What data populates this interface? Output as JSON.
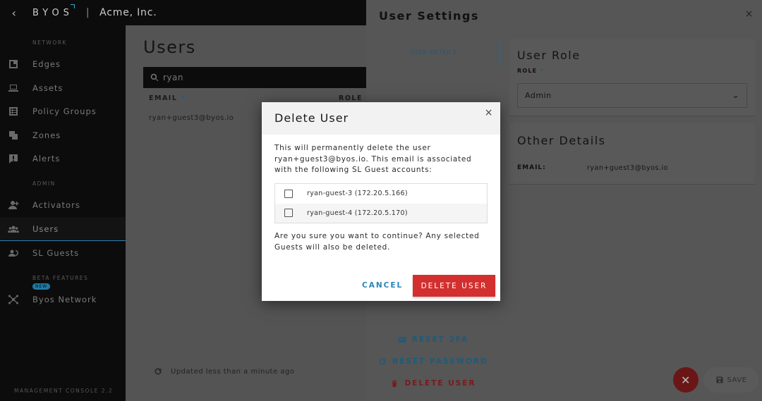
{
  "header": {
    "back_icon": "chevron-left-icon",
    "logo": "BYOS",
    "separator": "|",
    "org_name": "Acme, Inc."
  },
  "sidebar": {
    "sections": {
      "network": "NETWORK",
      "admin": "ADMIN",
      "beta": "BETA FEATURES"
    },
    "items": [
      {
        "label": "Edges",
        "icon": "edge-icon"
      },
      {
        "label": "Assets",
        "icon": "laptop-icon"
      },
      {
        "label": "Policy Groups",
        "icon": "policy-icon"
      },
      {
        "label": "Zones",
        "icon": "zones-icon"
      },
      {
        "label": "Alerts",
        "icon": "alert-icon"
      },
      {
        "label": "Activators",
        "icon": "add-person-icon"
      },
      {
        "label": "Users",
        "icon": "people-icon",
        "active": true
      },
      {
        "label": "SL Guests",
        "icon": "guests-icon"
      },
      {
        "label": "Byos Network",
        "icon": "network-icon",
        "badge": "NEW"
      }
    ],
    "footer": "MANAGEMENT CONSOLE 2.2"
  },
  "main": {
    "title": "Users",
    "search": {
      "value": "ryan",
      "icon": "search-icon"
    },
    "columns": {
      "email": "EMAIL",
      "sort_icon": "↑",
      "role": "ROLE"
    },
    "rows": [
      {
        "email": "ryan+guest3@byos.io"
      }
    ],
    "updated": "Updated less than a minute ago"
  },
  "panel": {
    "title": "User Settings",
    "close": "×",
    "tab": "USER DETAILS",
    "role_card": {
      "title": "User Role",
      "label": "ROLE",
      "required": "*",
      "value": "Admin"
    },
    "details_card": {
      "title": "Other Details",
      "email_label": "EMAIL:",
      "email_value": "ryan+guest3@byos.io"
    },
    "actions": {
      "reset_2fa": "RESET 2FA",
      "reset_password": "RESET PASSWORD",
      "delete_user": "DELETE USER"
    },
    "save": "SAVE",
    "colors": {
      "blue": "#2a84b8",
      "red": "#d32f2f"
    }
  },
  "dialog": {
    "title": "Delete User",
    "close": "×",
    "message": "This will permanently delete the user ryan+guest3@byos.io. This email is associated with the following SL Guest accounts:",
    "guests": [
      {
        "label": "ryan-guest-3 (172.20.5.166)",
        "checked": false
      },
      {
        "label": "ryan-guest-4 (172.20.5.170)",
        "checked": false
      }
    ],
    "confirm": "Are you sure you want to continue? Any selected Guests will also be deleted.",
    "cancel": "CANCEL",
    "delete": "DELETE USER"
  }
}
